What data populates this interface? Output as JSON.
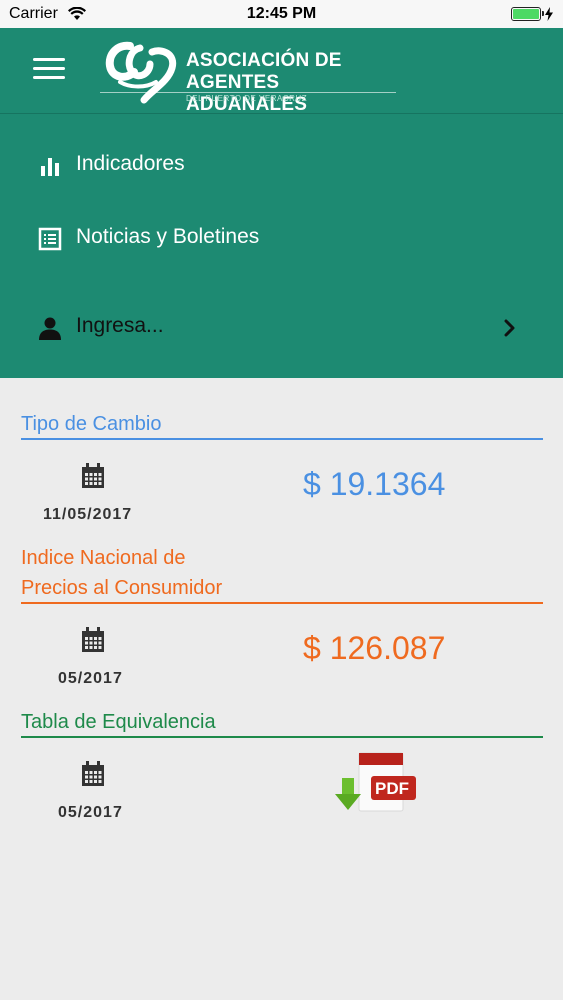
{
  "status_bar": {
    "carrier": "Carrier",
    "time": "12:45 PM",
    "battery_level": 1.0
  },
  "header": {
    "menu_icon": "hamburger-icon",
    "logo": {
      "line1": "ASOCIACIÓN DE",
      "line2": "AGENTES ADUANALES",
      "line3": "DEL PUERTO DE VERACRUZ"
    },
    "color": "#1d8a72"
  },
  "drawer": {
    "items": [
      {
        "label": "Indicadores",
        "icon": "bar-chart-icon"
      },
      {
        "label": "Noticias y Boletines",
        "icon": "list-icon"
      },
      {
        "label": "Ingresa...",
        "icon": "user-icon"
      }
    ]
  },
  "sections": {
    "tipo_cambio": {
      "title": "Tipo de Cambio",
      "date": "11/05/2017",
      "value": "$ 19.1364",
      "color": "#4a90e2"
    },
    "inpc": {
      "title_line1": "Indice Nacional de",
      "title_line2": "Precios al Consumidor",
      "date": "05/2017",
      "value": "$ 126.087",
      "color": "#ef6a1f"
    },
    "equivalencia": {
      "title": "Tabla de Equivalencia",
      "date": "05/2017",
      "pdf_label": "PDF",
      "color": "#1e8a4a"
    }
  }
}
